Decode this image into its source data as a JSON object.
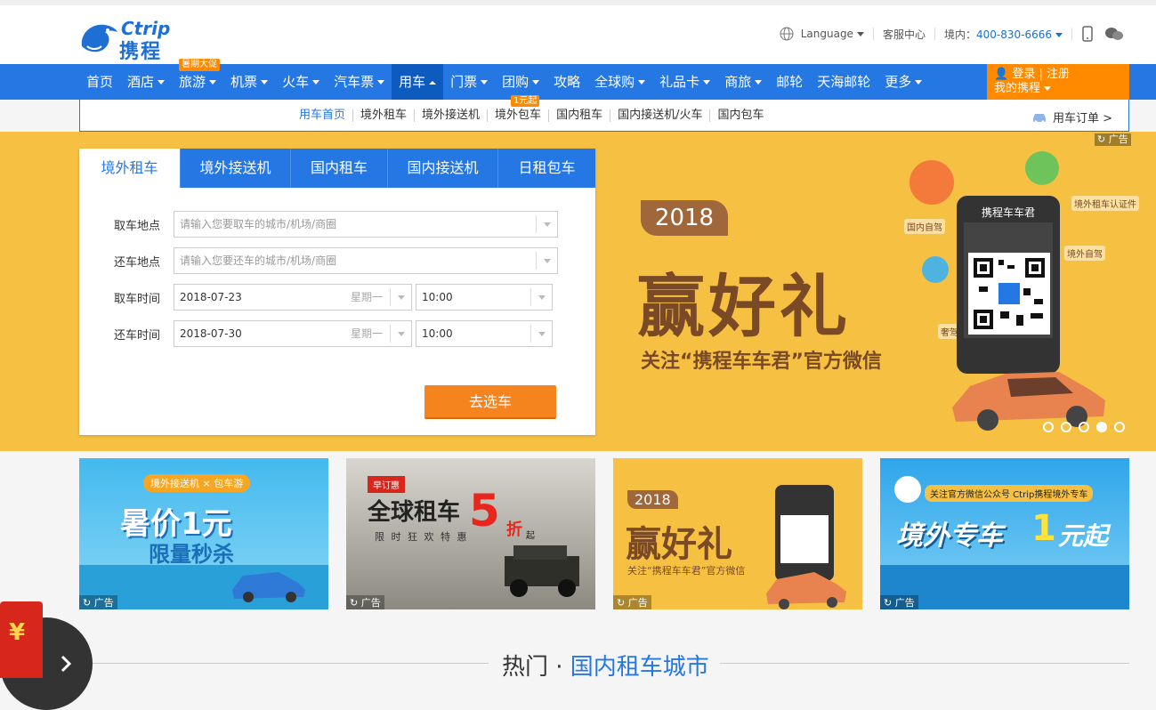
{
  "header": {
    "logo_en": "Ctrip",
    "logo_cn": "携程",
    "language": "Language",
    "service": "客服中心",
    "region_label": "境内：",
    "phone": "400-830-6666"
  },
  "nav": {
    "items": [
      {
        "label": "首页",
        "caret": false
      },
      {
        "label": "酒店",
        "caret": true
      },
      {
        "label": "旅游",
        "caret": true,
        "badge": "暑期大促"
      },
      {
        "label": "机票",
        "caret": true
      },
      {
        "label": "火车",
        "caret": true
      },
      {
        "label": "汽车票",
        "caret": true
      },
      {
        "label": "用车",
        "caret": true,
        "active": true
      },
      {
        "label": "门票",
        "caret": true
      },
      {
        "label": "团购",
        "caret": true
      },
      {
        "label": "攻略",
        "caret": false
      },
      {
        "label": "全球购",
        "caret": true
      },
      {
        "label": "礼品卡",
        "caret": true
      },
      {
        "label": "商旅",
        "caret": true
      },
      {
        "label": "邮轮",
        "caret": false
      },
      {
        "label": "天海邮轮",
        "caret": false
      },
      {
        "label": "更多",
        "caret": true
      }
    ],
    "login": "登录",
    "register": "注册",
    "my_ctrip": "我的携程"
  },
  "subnav": {
    "items": [
      "用车首页",
      "境外租车",
      "境外接送机",
      "境外包车",
      "国内租车",
      "国内接送机/火车",
      "国内包车"
    ],
    "badge": "1元起",
    "order": "用车订单 >"
  },
  "search": {
    "tabs": [
      "境外租车",
      "境外接送机",
      "国内租车",
      "国内接送机",
      "日租包车"
    ],
    "pickup_label": "取车地点",
    "pickup_placeholder": "请输入您要取车的城市/机场/商圈",
    "return_label": "还车地点",
    "return_placeholder": "请输入您要还车的城市/机场/商圈",
    "pickup_time_label": "取车时间",
    "pickup_date": "2018-07-23",
    "pickup_week": "星期一",
    "pickup_time": "10:00",
    "return_time_label": "还车时间",
    "return_date": "2018-07-30",
    "return_week": "星期一",
    "return_time": "10:00",
    "submit": "去选车"
  },
  "banner": {
    "ad": "广告",
    "year": "2018",
    "title": "赢好礼",
    "subtitle": "关注“携程车车君”官方微信",
    "phone_title": "携程车车君",
    "labels": [
      "国内自驾",
      "境外租车认证件",
      "境外自驾",
      "奢驾"
    ],
    "slides": 5,
    "active_slide": 4
  },
  "promos": [
    {
      "line1": "境外接送机 × 包车游",
      "line2": "暑价1元",
      "line3": "限量秒杀",
      "ad": "广告",
      "color": "#3fb4e8"
    },
    {
      "line1": "早订惠",
      "line2": "全球租车",
      "line3": "限 时 狂 欢 特 惠",
      "num": "5",
      "unit": "折",
      "suffix": "起",
      "ad": "广告",
      "color": "#a9a9a0"
    },
    {
      "line1": "2018",
      "line2": "赢好礼",
      "line3": "关注“携程车车君”官方微信",
      "ad": "广告",
      "color": "#f6c143"
    },
    {
      "line1": "关注官方微信公众号 Ctrip携程境外专车",
      "line2": "境外专车",
      "num": "1",
      "line3": "元起",
      "ad": "广告",
      "color": "#2fa6ea"
    }
  ],
  "hot": {
    "prefix": "热门 · ",
    "title": "国内租车城市"
  }
}
